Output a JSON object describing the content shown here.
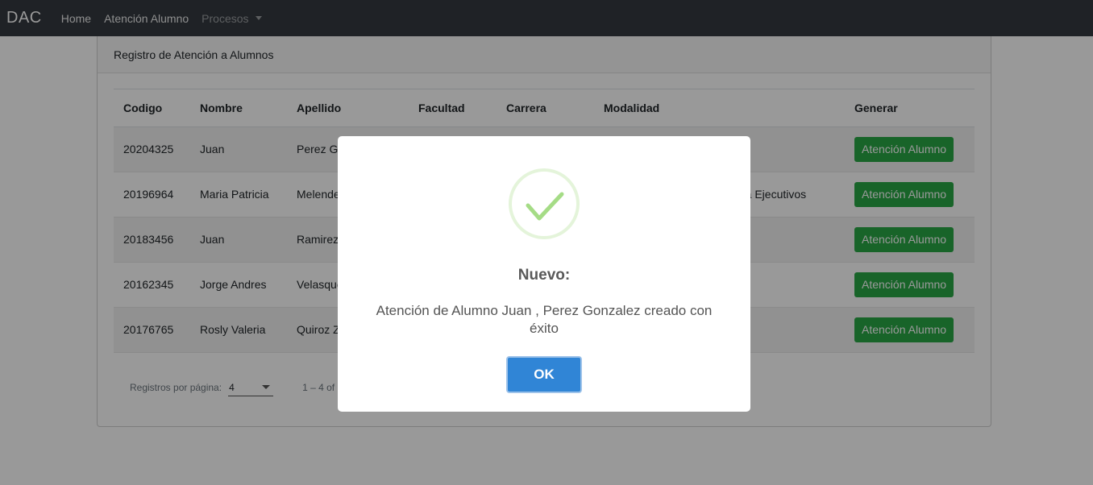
{
  "navbar": {
    "brand": "DAC",
    "links": [
      "Home",
      "Atención Alumno"
    ],
    "dropdown": "Procesos"
  },
  "card": {
    "title": "Registro de Atención a Alumnos"
  },
  "table": {
    "headers": [
      "Codigo",
      "Nombre",
      "Apellido",
      "Facultad",
      "Carrera",
      "Modalidad",
      "Generar"
    ],
    "rows": [
      {
        "codigo": "20204325",
        "nombre": "Juan",
        "apellido": "Perez Go",
        "modalidad": "",
        "button": "Atención Alumno"
      },
      {
        "codigo": "20196964",
        "nombre": "Maria Patricia",
        "apellido": "Melende",
        "modalidad": "ra Ejecutivos",
        "button": "Atención Alumno"
      },
      {
        "codigo": "20183456",
        "nombre": "Juan",
        "apellido": "Ramirez",
        "modalidad": "",
        "button": "Atención Alumno"
      },
      {
        "codigo": "20162345",
        "nombre": "Jorge Andres",
        "apellido": "Velasque",
        "modalidad": "",
        "button": "Atención Alumno"
      },
      {
        "codigo": "20176765",
        "nombre": "Rosly Valeria",
        "apellido": "Quiroz Z",
        "modalidad": "",
        "button": "Atención Alumno"
      }
    ]
  },
  "paginator": {
    "label": "Registros por página:",
    "page_size": "4",
    "range": "1 – 4 of"
  },
  "modal": {
    "icon": "success-check-icon",
    "title": "Nuevo:",
    "text": "Atención de Alumno Juan , Perez Gonzalez creado con éxito",
    "ok_label": "OK"
  },
  "colors": {
    "navbar": "#343a40",
    "button_green": "#28a745",
    "ok_blue": "#3085d6",
    "check_green": "#a5dc86"
  }
}
